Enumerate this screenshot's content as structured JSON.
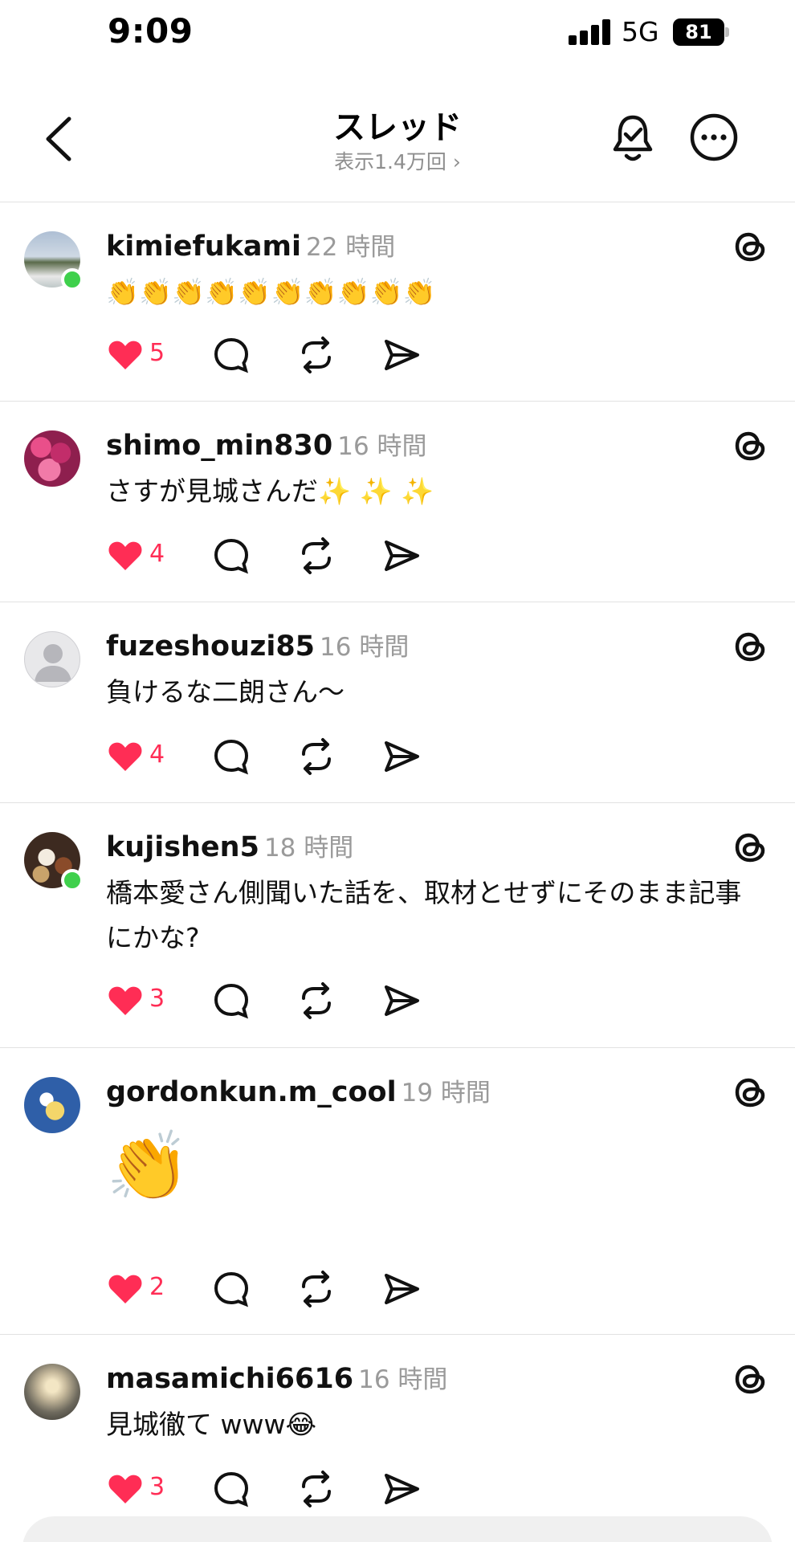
{
  "status_bar": {
    "time": "9:09",
    "network": "5G",
    "battery": "81"
  },
  "header": {
    "title": "スレッド",
    "subtitle": "表示1.4万回 ›"
  },
  "posts": [
    {
      "username": "kimiefukami",
      "time": "22 時間",
      "text": "👏👏👏👏👏👏👏👏👏👏",
      "likes": "5"
    },
    {
      "username": "shimo_min830",
      "time": "16 時間",
      "text": "さすが見城さんだ✨ ✨ ✨",
      "likes": "4"
    },
    {
      "username": "fuzeshouzi85",
      "time": "16 時間",
      "text": "負けるな二朗さん〜",
      "likes": "4"
    },
    {
      "username": "kujishen5",
      "time": "18 時間",
      "text": "橋本愛さん側聞いた話を、取材とせずにそのまま記事にかな?",
      "likes": "3"
    },
    {
      "username": "gordonkun.m_cool",
      "time": "19 時間",
      "text": "👏",
      "likes": "2"
    },
    {
      "username": "masamichi6616",
      "time": "16 時間",
      "text": "見城徹て www😂",
      "likes": "3"
    }
  ],
  "colors": {
    "like": "#ff2d55",
    "online": "#3fd04c",
    "muted": "#9a9a9a",
    "divider": "#e2e2e2"
  },
  "icons": [
    "back-chevron-icon",
    "bell-check-icon",
    "more-icon",
    "heart-icon",
    "comment-icon",
    "repost-icon",
    "share-icon",
    "threads-logo-icon"
  ]
}
